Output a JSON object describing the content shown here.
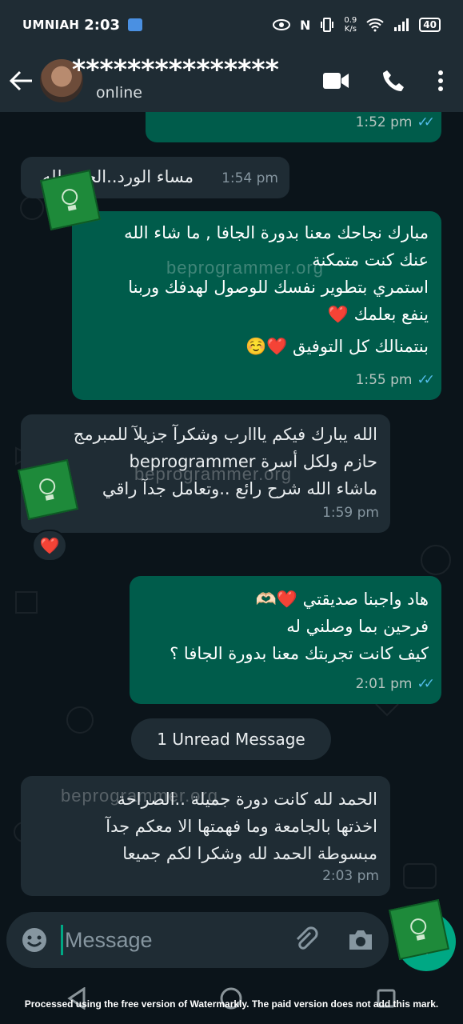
{
  "status_bar": {
    "carrier": "UMNIAH",
    "time": "2:03",
    "net_speed_value": "0.9",
    "net_speed_unit": "K/s",
    "battery": "40"
  },
  "header": {
    "contact_name": "***************",
    "contact_status": "online"
  },
  "messages": [
    {
      "direction": "out",
      "text": "",
      "time": "1:52 pm",
      "read": true
    },
    {
      "direction": "in",
      "text": "مساء الورد..الحمد لله",
      "time": "1:54 pm"
    },
    {
      "direction": "out",
      "lines": [
        "مبارك نجاحك معنا بدورة الجافا , ما شاء الله",
        "عنك كنت متمكنة",
        "استمري بتطوير نفسك للوصول لهدفك وربنا",
        "ينفع بعلمك ❤️",
        "بنتمنالك كل التوفيق ❤️☺️"
      ],
      "time": "1:55 pm",
      "read": true
    },
    {
      "direction": "in",
      "lines": [
        "الله يبارك فيكم يااارب وشكرآ جزيلآ للمبرمج",
        "حازم ولكل أسرة beprogrammer",
        "ماشاء الله شرح رائع ..وتعامل جدآ راقي"
      ],
      "time": "1:59 pm",
      "reaction": "❤️"
    },
    {
      "direction": "out",
      "lines": [
        "هاد واجبنا صديقتي ❤️🫶🏻",
        "فرحين بما وصلني له",
        "كيف كانت تجربتك معنا بدورة الجافا ؟"
      ],
      "time": "2:01 pm",
      "read": true
    },
    {
      "direction": "in",
      "lines": [
        "الحمد لله كانت دورة جميلة ..الصراحة",
        "اخذتها بالجامعة وما فهمتها الا معكم جدآ",
        "مبسوطة الحمد لله وشكرا لكم جميعا"
      ],
      "time": "2:03 pm"
    }
  ],
  "unread_pill": "1 Unread Message",
  "watermark_text": "beprogrammer.org",
  "composer": {
    "placeholder": "Message"
  },
  "footer_watermark": "Processed using the free version of Watermarkly. The paid version does not add this mark.",
  "colors": {
    "outgoing_bubble": "#005c4b",
    "incoming_bubble": "#1f2c34",
    "background": "#0b141a",
    "accent": "#00a884",
    "read_ticks": "#53bdeb"
  }
}
